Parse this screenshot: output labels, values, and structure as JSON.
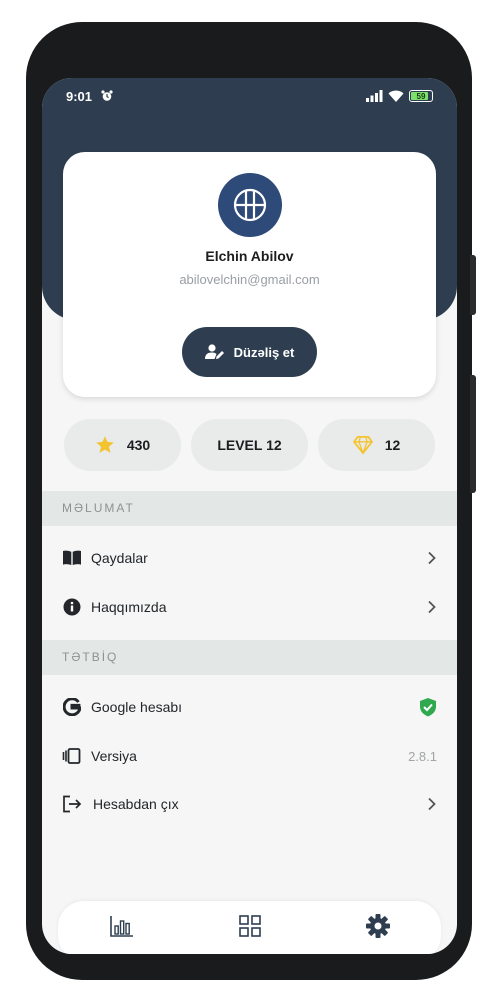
{
  "status_bar": {
    "time": "9:01",
    "battery": "59"
  },
  "profile": {
    "name": "Elchin Abilov",
    "email": "abilovelchin@gmail.com",
    "edit_button": "Düzəliş et"
  },
  "stats": [
    {
      "icon": "star-icon",
      "value": "430"
    },
    {
      "value": "LEVEL 12"
    },
    {
      "icon": "diamond-icon",
      "value": "12"
    }
  ],
  "sections": {
    "info_title": "MƏLUMAT",
    "app_title": "TƏTBİQ"
  },
  "info_items": [
    {
      "icon": "book-icon",
      "label": "Qaydalar"
    },
    {
      "icon": "info-icon",
      "label": "Haqqımızda"
    }
  ],
  "app_items": [
    {
      "icon": "google-icon",
      "label": "Google hesabı",
      "status_icon": "shield-check-icon"
    },
    {
      "icon": "vibrate-icon",
      "label": "Versiya",
      "value": "2.8.1"
    },
    {
      "icon": "logout-icon",
      "label": "Hesabdan çıx"
    }
  ],
  "nav": [
    "bar-chart-icon",
    "grid-icon",
    "settings-gear-icon"
  ],
  "colors": {
    "header": "#2e3e50",
    "accent_gold": "#f4c430",
    "success": "#2fa84f"
  }
}
